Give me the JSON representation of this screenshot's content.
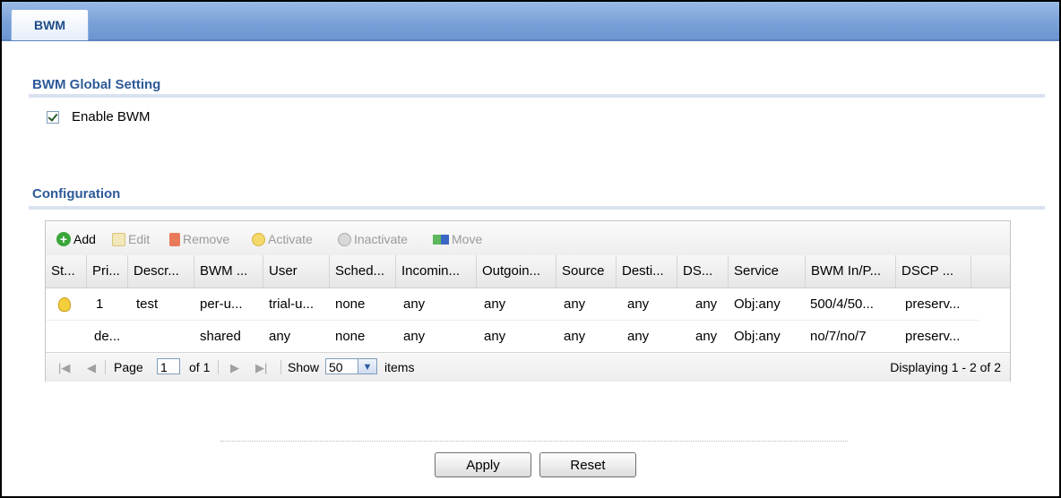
{
  "tabs": [
    {
      "label": "BWM"
    }
  ],
  "global": {
    "title": "BWM Global Setting",
    "enable_label": "Enable BWM",
    "enable_checked": true
  },
  "config": {
    "title": "Configuration",
    "toolbar": {
      "add": "Add",
      "edit": "Edit",
      "remove": "Remove",
      "activate": "Activate",
      "inactivate": "Inactivate",
      "move": "Move"
    },
    "columns": [
      "St...",
      "Pri...",
      "Descr...",
      "BWM ...",
      "User",
      "Sched...",
      "Incomin...",
      "Outgoin...",
      "Source",
      "Desti...",
      "DS...",
      "Service",
      "BWM In/P...",
      "DSCP ..."
    ],
    "rows": [
      {
        "status_icon": "bulb-on-icon",
        "cells": [
          "",
          "1",
          "test",
          "per-u...",
          "trial-u...",
          "none",
          "any",
          "any",
          "any",
          "any",
          "any",
          "Obj:any",
          "500/4/50...",
          "preserv..."
        ]
      },
      {
        "status_icon": "",
        "cells": [
          "",
          "de...",
          "",
          "shared",
          "any",
          "none",
          "any",
          "any",
          "any",
          "any",
          "any",
          "Obj:any",
          "no/7/no/7",
          "preserv..."
        ]
      }
    ],
    "pager": {
      "page_label": "Page",
      "page_value": "1",
      "of_label": "of 1",
      "show_label": "Show",
      "show_value": "50",
      "items_label": "items",
      "displaying": "Displaying 1 - 2 of 2"
    }
  },
  "buttons": {
    "apply": "Apply",
    "reset": "Reset"
  },
  "colors": {
    "section_title": "#2d5a98",
    "tab_bar": "#7aa1d8"
  }
}
